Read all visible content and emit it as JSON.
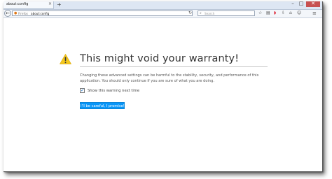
{
  "tab": {
    "title": "about:config",
    "close": "×",
    "new_tab": "+"
  },
  "window_controls": {
    "minimize": "–",
    "maximize": "□",
    "close": "✕"
  },
  "navbar": {
    "back": "←",
    "identity_icon": "firefox-icon",
    "brand": "Firefox",
    "url": "about:config",
    "reload": "↻",
    "search_placeholder": "Search",
    "icons": [
      "star-icon",
      "reader-icon",
      "pocket-icon",
      "download-icon",
      "home-icon",
      "chat-icon",
      "menu-icon"
    ]
  },
  "warning": {
    "icon": "warning-icon",
    "title": "This might void your warranty!",
    "text": "Changing these advanced settings can be harmful to the stability, security, and performance of this application. You should only continue if you are sure of what you are doing.",
    "checkbox_label": "Show this warning next time",
    "checkbox_checked": true,
    "button_label": "I'll be careful, I promise!"
  },
  "colors": {
    "accent": "#0996f8",
    "warning": "#f4c81e",
    "url_icon": "#e07a1a"
  }
}
